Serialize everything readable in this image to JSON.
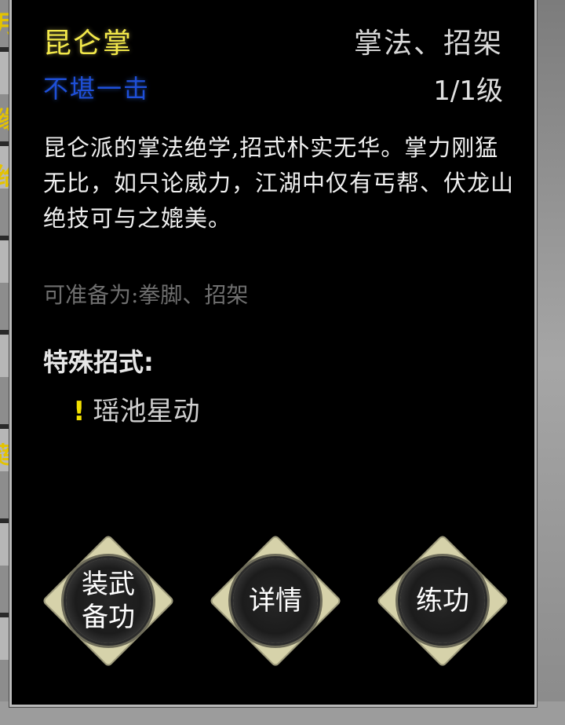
{
  "background": {
    "edge_glyphs": [
      "月",
      "缘",
      "给",
      "莲"
    ]
  },
  "skill": {
    "name": "昆仑掌",
    "type": "掌法、招架",
    "grade": "不堪一击",
    "level": "1/1级",
    "description": "昆仑派的掌法绝学,招式朴实无华。掌力刚猛无比，如只论威力，江湖中仅有丐帮、伏龙山绝技可与之媲美。",
    "equip_as": "可准备为:拳脚、招架"
  },
  "special": {
    "title": "特殊招式:",
    "mark": "!",
    "items": [
      "瑶池星动"
    ]
  },
  "buttons": {
    "equip": "装武\n备功",
    "details": "详情",
    "practice": "练功"
  },
  "colors": {
    "name": "#f2e84a",
    "grade": "#1e4fd8",
    "button_diamond": "#d6d2aa"
  }
}
